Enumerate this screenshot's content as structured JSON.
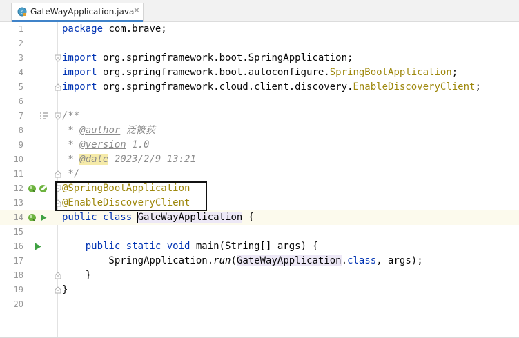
{
  "editor": {
    "tab": {
      "file_name": "GateWayApplication.java",
      "close_glyph": "✕",
      "file_icon": "java-class-icon"
    },
    "accent_color": "#4083c9",
    "current_line": 14,
    "lines": [
      {
        "n": "1",
        "tokens": [
          {
            "t": "package",
            "c": "kw"
          },
          {
            "t": " com.brave;",
            "c": ""
          }
        ]
      },
      {
        "n": "2",
        "tokens": []
      },
      {
        "n": "3",
        "tokens": [
          {
            "t": "import",
            "c": "kw"
          },
          {
            "t": " org.springframework.boot.SpringApplication;",
            "c": ""
          }
        ]
      },
      {
        "n": "4",
        "tokens": [
          {
            "t": "import",
            "c": "kw"
          },
          {
            "t": " org.springframework.boot.autoconfigure.",
            "c": ""
          },
          {
            "t": "SpringBootApplication",
            "c": "ann"
          },
          {
            "t": ";",
            "c": ""
          }
        ]
      },
      {
        "n": "5",
        "tokens": [
          {
            "t": "import",
            "c": "kw"
          },
          {
            "t": " org.springframework.cloud.client.discovery.",
            "c": ""
          },
          {
            "t": "EnableDiscoveryClient",
            "c": "ann"
          },
          {
            "t": ";",
            "c": ""
          }
        ]
      },
      {
        "n": "6",
        "tokens": []
      },
      {
        "n": "7",
        "tokens": [
          {
            "t": "/**",
            "c": "cm"
          }
        ]
      },
      {
        "n": "8",
        "tokens": [
          {
            "t": " * ",
            "c": "cm"
          },
          {
            "t": "@author",
            "c": "tag"
          },
          {
            "t": " 泛筱荻",
            "c": "cm"
          }
        ]
      },
      {
        "n": "9",
        "tokens": [
          {
            "t": " * ",
            "c": "cm"
          },
          {
            "t": "@version",
            "c": "tag"
          },
          {
            "t": " 1.0",
            "c": "cm"
          }
        ]
      },
      {
        "n": "10",
        "tokens": [
          {
            "t": " * ",
            "c": "cm"
          },
          {
            "t": "@date",
            "c": "tag bg"
          },
          {
            "t": " 2023/2/9 13:21",
            "c": "cm"
          }
        ]
      },
      {
        "n": "11",
        "tokens": [
          {
            "t": " */",
            "c": "cm"
          }
        ]
      },
      {
        "n": "12",
        "tokens": [
          {
            "t": "@SpringBootApplication",
            "c": "ann"
          }
        ]
      },
      {
        "n": "13",
        "tokens": [
          {
            "t": "@EnableDiscoveryClient",
            "c": "ann"
          }
        ]
      },
      {
        "n": "14",
        "tokens": [
          {
            "t": "public class ",
            "c": "kw"
          },
          {
            "t": "",
            "c": "caret"
          },
          {
            "t": "GateWayApplication",
            "c": "ident"
          },
          {
            "t": " {",
            "c": ""
          }
        ]
      },
      {
        "n": "15",
        "tokens": []
      },
      {
        "n": "16",
        "tokens": [
          {
            "t": "    ",
            "c": ""
          },
          {
            "t": "public static void ",
            "c": "kw"
          },
          {
            "t": "main",
            "c": "fn"
          },
          {
            "t": "(String[] args) {",
            "c": ""
          }
        ]
      },
      {
        "n": "17",
        "tokens": [
          {
            "t": "        SpringApplication.",
            "c": ""
          },
          {
            "t": "run",
            "c": "ital"
          },
          {
            "t": "(",
            "c": ""
          },
          {
            "t": "GateWayApplication",
            "c": "ident"
          },
          {
            "t": ".",
            "c": ""
          },
          {
            "t": "class",
            "c": "kw"
          },
          {
            "t": ", args);",
            "c": ""
          }
        ]
      },
      {
        "n": "18",
        "tokens": [
          {
            "t": "    }",
            "c": ""
          }
        ]
      },
      {
        "n": "19",
        "tokens": [
          {
            "t": "}",
            "c": ""
          }
        ]
      },
      {
        "n": "20",
        "tokens": []
      }
    ],
    "gutter_icons": [
      {
        "line": 7,
        "icon": "render-doc-icon"
      },
      {
        "line": 12,
        "icon": "spring-bean-icon"
      },
      {
        "line": 12,
        "icon": "spring-config-icon"
      },
      {
        "line": 14,
        "icon": "spring-bean-icon"
      },
      {
        "line": 14,
        "icon": "run-icon"
      },
      {
        "line": 16,
        "icon": "run-icon"
      }
    ]
  }
}
